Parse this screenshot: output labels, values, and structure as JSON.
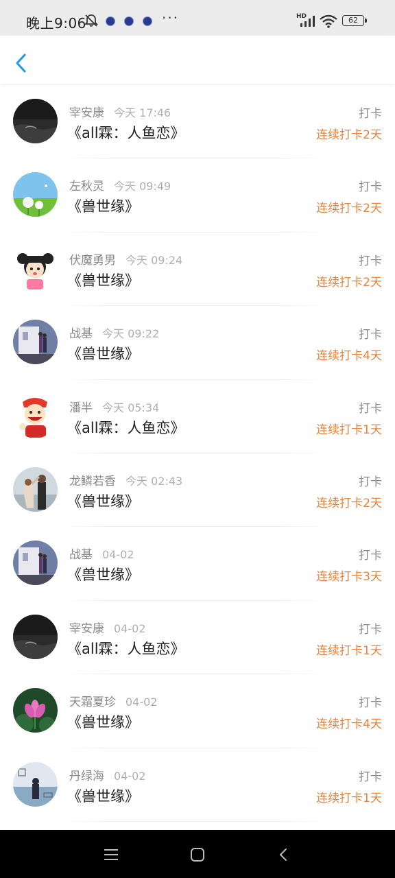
{
  "status_bar": {
    "time": "晚上9:06",
    "more": "···",
    "network_type": "HD",
    "battery": "62"
  },
  "colors": {
    "accent_blue": "#1e9be0",
    "streak_orange": "#e8823a",
    "name_gray": "#8a8a8a"
  },
  "header": {
    "back_icon": "chevron-left-icon"
  },
  "rows": [
    {
      "name": "宰安康",
      "time": "今天 17:46",
      "book": "《all霖：人鱼恋》",
      "action": "打卡",
      "streak": "连续打卡2天",
      "avatar": "dark-water"
    },
    {
      "name": "左秋灵",
      "time": "今天 09:49",
      "book": "《兽世缘》",
      "action": "打卡",
      "streak": "连续打卡2天",
      "avatar": "dandelion-meadow"
    },
    {
      "name": "伏魔勇男",
      "time": "今天 09:24",
      "book": "《兽世缘》",
      "action": "打卡",
      "streak": "连续打卡2天",
      "avatar": "cartoon-girl"
    },
    {
      "name": "战基",
      "time": "今天 09:22",
      "book": "《兽世缘》",
      "action": "打卡",
      "streak": "连续打卡4天",
      "avatar": "couple-building"
    },
    {
      "name": "潘半",
      "time": "今天 05:34",
      "book": "《all霖：人鱼恋》",
      "action": "打卡",
      "streak": "连续打卡1天",
      "avatar": "cartoon-boy"
    },
    {
      "name": "龙鳞若香",
      "time": "今天 02:43",
      "book": "《兽世缘》",
      "action": "打卡",
      "streak": "连续打卡2天",
      "avatar": "couple-dance"
    },
    {
      "name": "战基",
      "time": "04-02",
      "book": "《兽世缘》",
      "action": "打卡",
      "streak": "连续打卡3天",
      "avatar": "couple-building"
    },
    {
      "name": "宰安康",
      "time": "04-02",
      "book": "《all霖：人鱼恋》",
      "action": "打卡",
      "streak": "连续打卡1天",
      "avatar": "dark-water"
    },
    {
      "name": "天霜夏珍",
      "time": "04-02",
      "book": "《兽世缘》",
      "action": "打卡",
      "streak": "连续打卡4天",
      "avatar": "lotus"
    },
    {
      "name": "丹绿海",
      "time": "04-02",
      "book": "《兽世缘》",
      "action": "打卡",
      "streak": "连续打卡1天",
      "avatar": "girl-lake"
    }
  ],
  "nav": {
    "menu_icon": "menu-icon",
    "home_icon": "home-icon",
    "back_icon": "back-icon"
  }
}
